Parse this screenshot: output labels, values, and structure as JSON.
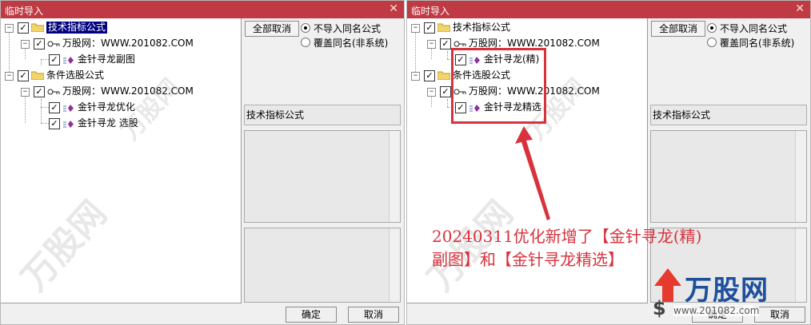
{
  "left": {
    "title": "临时导入",
    "close_glyph": "✕",
    "tree": {
      "tech_group": "技术指标公式",
      "tech_site": "万股网：WWW.201082.COM",
      "tech_item": "金针寻龙副图",
      "cond_group": "条件选股公式",
      "cond_site": "万股网：WWW.201082.COM",
      "cond_item1": "金针寻龙优化",
      "cond_item2": "金针寻龙 选股"
    },
    "cancel_all": "全部取消",
    "radio_no_import": "不导入同名公式",
    "radio_overwrite": "覆盖同名(非系统)",
    "desc_label": "技术指标公式",
    "ok": "确定",
    "cancel": "取消"
  },
  "right": {
    "title": "临时导入",
    "close_glyph": "✕",
    "tree": {
      "tech_group": "技术指标公式",
      "tech_site": "万股网：WWW.201082.COM",
      "tech_item": "金针寻龙(精)",
      "cond_group": "条件选股公式",
      "cond_site": "万股网：WWW.201082.COM",
      "cond_item1": "金针寻龙精选"
    },
    "cancel_all": "全部取消",
    "radio_no_import": "不导入同名公式",
    "radio_overwrite": "覆盖同名(非系统)",
    "desc_label": "技术指标公式",
    "ok": "确定",
    "cancel": "取消"
  },
  "annotation": {
    "line1": "20240311优化新增了【金针寻龙(精)",
    "line2": "副图】和【金针寻龙精选】",
    "color": "#d8323c"
  },
  "brand": {
    "name": "万股网",
    "url": "www.201082.com"
  },
  "colors": {
    "titlebar": "#bf3a42",
    "selection": "#000080"
  }
}
